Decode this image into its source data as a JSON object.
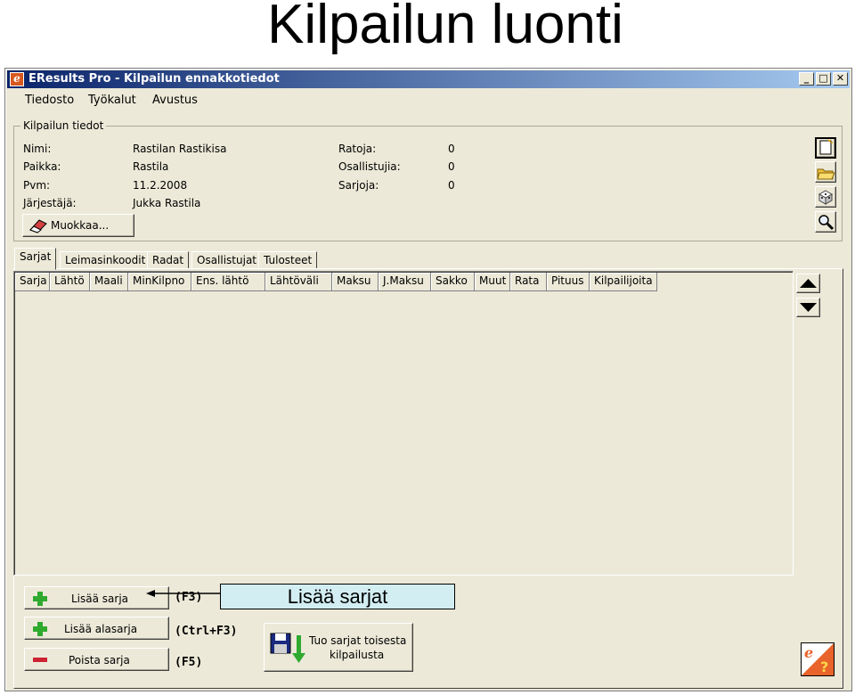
{
  "slide": {
    "title": "Kilpailun luonti"
  },
  "window": {
    "title": "EResults Pro - Kilpailun ennakkotiedot",
    "icon": "eresults-logo-icon"
  },
  "menu": [
    "Tiedosto",
    "Työkalut",
    "Avustus"
  ],
  "info_group": {
    "label": "Kilpailun tiedot",
    "left_fields": [
      {
        "label": "Nimi:",
        "value": "Rastilan Rastikisa"
      },
      {
        "label": "Paikka:",
        "value": "Rastila"
      },
      {
        "label": "Pvm:",
        "value": "11.2.2008"
      },
      {
        "label": "Järjestäjä:",
        "value": "Jukka Rastila"
      }
    ],
    "right_fields": [
      {
        "label": "Ratoja:",
        "value": "0"
      },
      {
        "label": "Osallistujia:",
        "value": "0"
      },
      {
        "label": "Sarjoja:",
        "value": "0"
      }
    ],
    "edit_button": "Muokkaa..."
  },
  "toolbar_icons": [
    "new-document-icon",
    "open-folder-icon",
    "dice-icon",
    "magnifier-icon"
  ],
  "tabs": [
    "Sarjat",
    "Leimasinkoodit",
    "Radat",
    "Osallistujat",
    "Tulosteet"
  ],
  "active_tab": "Sarjat",
  "grid": {
    "columns": [
      "Sarja",
      "Lähtö",
      "Maali",
      "MinKilpno",
      "Ens. lähtö",
      "Lähtöväli",
      "Maksu",
      "J.Maksu",
      "Sakko",
      "Muut",
      "Rata",
      "Pituus",
      "Kilpailijoita"
    ]
  },
  "actions": {
    "add_series": {
      "label": "Lisää sarja",
      "shortcut": "(F3)"
    },
    "add_subseries": {
      "label": "Lisää alasarja",
      "shortcut": "(Ctrl+F3)"
    },
    "delete_series": {
      "label": "Poista sarja",
      "shortcut": "(F5)"
    },
    "import_series": {
      "label_line1": "Tuo sarjat toisesta",
      "label_line2": "kilpailusta"
    }
  },
  "callout": {
    "text": "Lisää sarjat"
  },
  "colors": {
    "titlebar_start": "#0a246a",
    "titlebar_end": "#a6caf0",
    "plus_green": "#2faa2f",
    "minus_red": "#cc2233",
    "callout_bg": "#d2eef2"
  }
}
